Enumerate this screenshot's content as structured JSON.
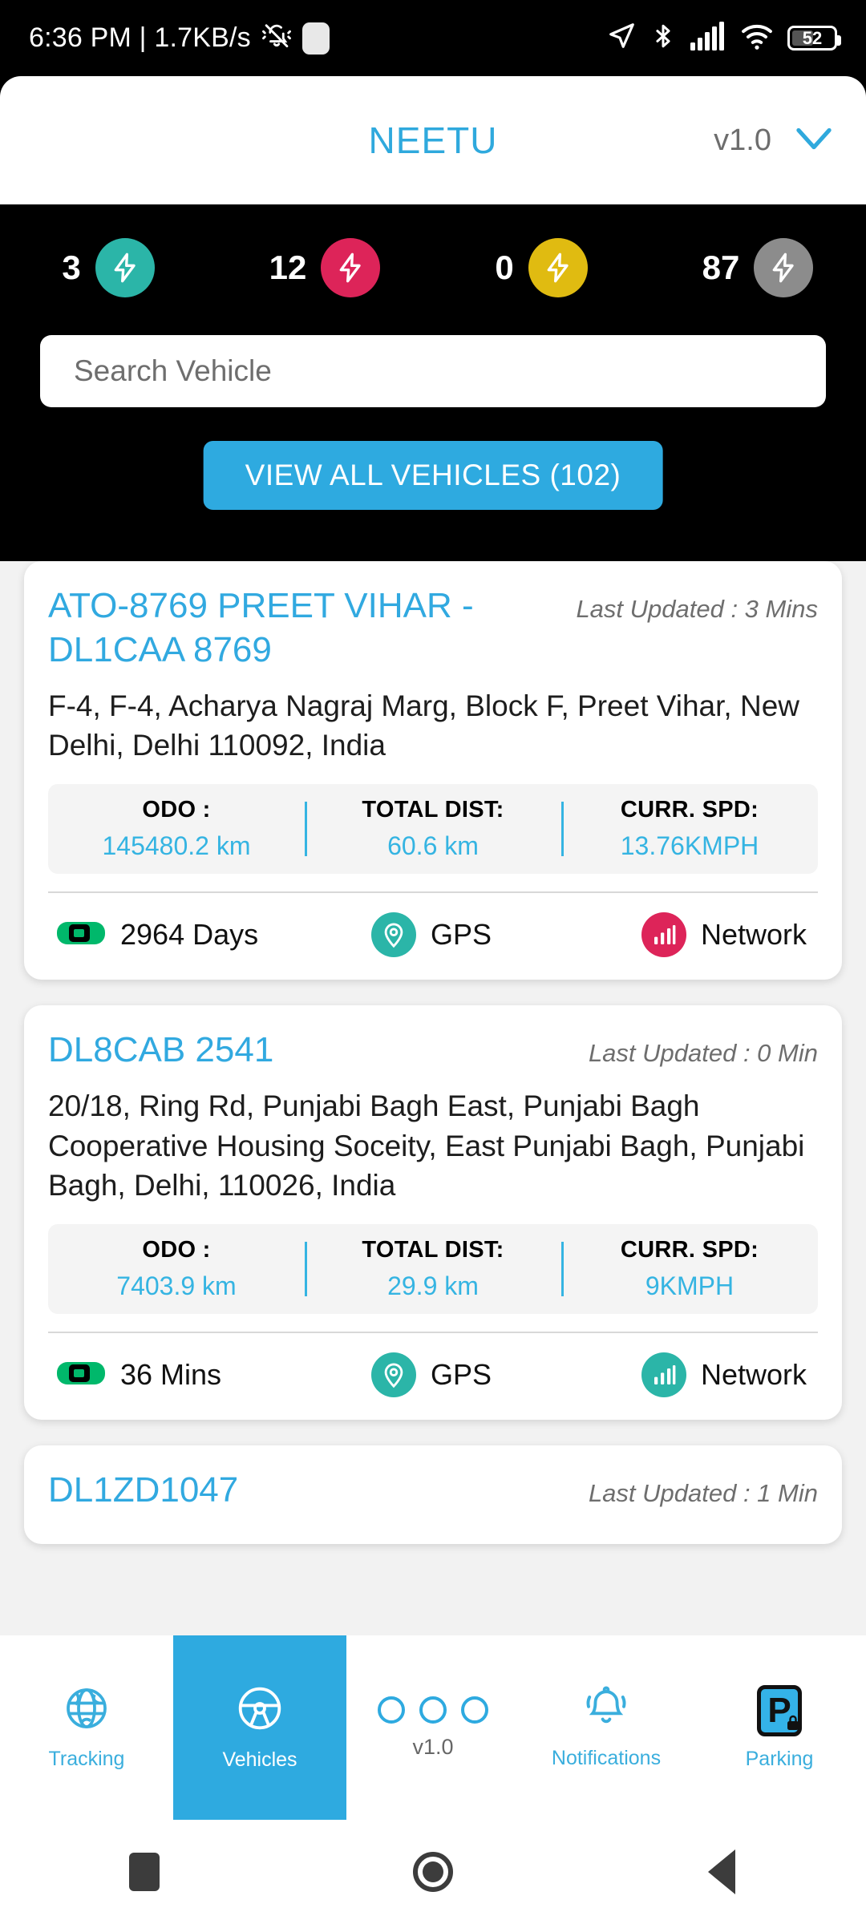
{
  "status_bar": {
    "time_and_speed": "6:36 PM | 1.7KB/s",
    "mute_icon": "bell-muted-icon",
    "blob_icon": "rounded-indicator-icon",
    "location_icon": "location-arrow-icon",
    "bluetooth_icon": "bluetooth-icon",
    "signal_icon": "cellular-signal-icon",
    "wifi_icon": "wifi-icon",
    "battery_percent": "52"
  },
  "header": {
    "title": "NEETU",
    "version": "v1.0",
    "chevron_icon": "chevron-down-icon"
  },
  "stats": [
    {
      "count": "3",
      "color": "#2bb5a8",
      "icon": "lightning-bolt-icon",
      "status": "running"
    },
    {
      "count": "12",
      "color": "#dd2459",
      "icon": "lightning-bolt-icon",
      "status": "stopped"
    },
    {
      "count": "0",
      "color": "#e0bb11",
      "icon": "lightning-bolt-icon",
      "status": "idle"
    },
    {
      "count": "87",
      "color": "#8c8c8c",
      "icon": "lightning-bolt-icon",
      "status": "offline"
    }
  ],
  "search": {
    "value": "",
    "placeholder": "Search Vehicle"
  },
  "view_all_button": {
    "label": "VIEW ALL VEHICLES (102)",
    "color": "#2eaae0"
  },
  "cards": [
    {
      "title": "ATO-8769 PREET VIHAR - DL1CAA 8769",
      "last_updated": "Last Updated : 3 Mins",
      "address": "F-4, F-4, Acharya Nagraj Marg, Block F, Preet Vihar, New Delhi, Delhi 110092, India",
      "metrics": [
        {
          "label": "ODO :",
          "value": "145480.2 km"
        },
        {
          "label": "TOTAL DIST:",
          "value": "60.6 km"
        },
        {
          "label": "CURR. SPD:",
          "value": "13.76KMPH"
        }
      ],
      "footer": {
        "duration": "2964 Days",
        "car_icon": "car-top-view-icon",
        "car_color": "#00b86b",
        "gps_label": "GPS",
        "gps_icon": "location-pin-icon",
        "gps_color": "#2bb5a8",
        "network_label": "Network",
        "network_icon": "signal-bars-icon",
        "network_color": "#dd2459"
      }
    },
    {
      "title": "DL8CAB 2541",
      "last_updated": "Last Updated : 0 Min",
      "address": "20/18, Ring Rd, Punjabi Bagh East, Punjabi Bagh Cooperative Housing Soceity, East Punjabi Bagh, Punjabi Bagh, Delhi, 110026, India",
      "metrics": [
        {
          "label": "ODO :",
          "value": "7403.9 km"
        },
        {
          "label": "TOTAL DIST:",
          "value": "29.9 km"
        },
        {
          "label": "CURR. SPD:",
          "value": "9KMPH"
        }
      ],
      "footer": {
        "duration": "36 Mins",
        "car_icon": "car-top-view-icon",
        "car_color": "#00b86b",
        "gps_label": "GPS",
        "gps_icon": "location-pin-icon",
        "gps_color": "#2bb5a8",
        "network_label": "Network",
        "network_icon": "signal-bars-icon",
        "network_color": "#2bb5a8"
      }
    },
    {
      "title": "DL1ZD1047",
      "last_updated": "Last Updated : 1 Min",
      "address": "",
      "metrics": [],
      "footer": null
    }
  ],
  "bottom_nav": [
    {
      "label": "Tracking",
      "icon": "globe-icon",
      "active": false
    },
    {
      "label": "Vehicles",
      "icon": "steering-wheel-icon",
      "active": true
    },
    {
      "label": "v1.0",
      "icon": "three-dots-icon",
      "active": false
    },
    {
      "label": "Notifications",
      "icon": "bell-icon",
      "active": false
    },
    {
      "label": "Parking",
      "icon": "parking-icon",
      "active": false
    }
  ],
  "android_nav": {
    "recents_icon": "recents-square-icon",
    "home_icon": "home-circle-icon",
    "back_icon": "back-triangle-icon"
  }
}
